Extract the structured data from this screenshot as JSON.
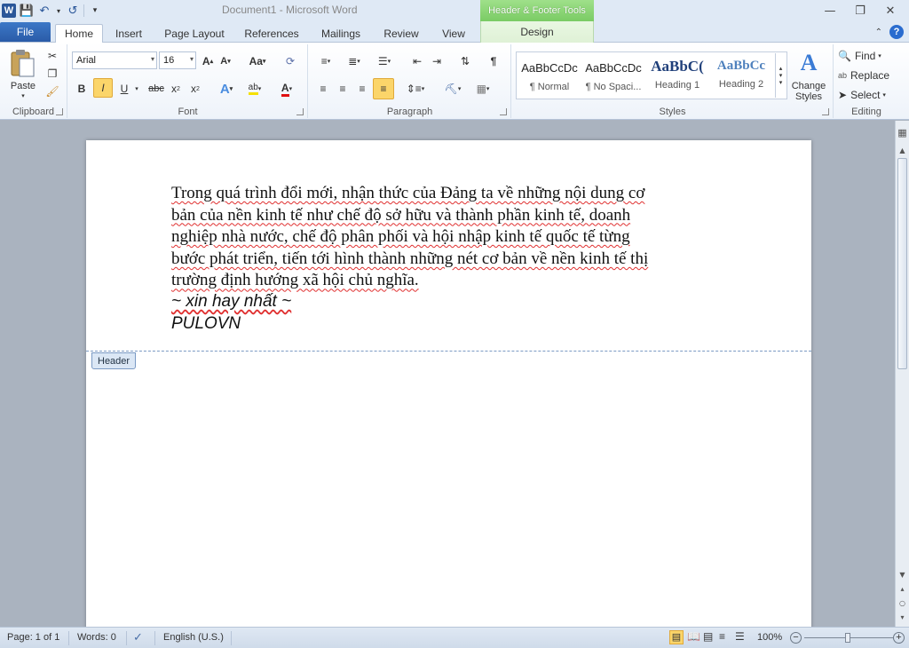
{
  "window": {
    "title": "Document1 - Microsoft Word",
    "context_tab_title": "Header & Footer Tools"
  },
  "tabs": {
    "file": "File",
    "items": [
      "Home",
      "Insert",
      "Page Layout",
      "References",
      "Mailings",
      "Review",
      "View"
    ],
    "design": "Design",
    "active": "Home"
  },
  "ribbon": {
    "clipboard": {
      "label": "Clipboard",
      "paste": "Paste"
    },
    "font": {
      "label": "Font",
      "name": "Arial",
      "size": "16"
    },
    "paragraph": {
      "label": "Paragraph"
    },
    "styles": {
      "label": "Styles",
      "items": [
        {
          "sample": "AaBbCcDc",
          "name": "¶ Normal"
        },
        {
          "sample": "AaBbCcDc",
          "name": "¶ No Spaci..."
        },
        {
          "sample": "AaBbC(",
          "name": "Heading 1"
        },
        {
          "sample": "AaBbCc",
          "name": "Heading 2"
        }
      ],
      "change_styles": "Change Styles"
    },
    "editing": {
      "label": "Editing",
      "find": "Find",
      "replace": "Replace",
      "select": "Select"
    }
  },
  "document": {
    "paragraph_lines": [
      "Trong quá trình đổi mới, nhận thức của Đảng ta về những nội dung cơ",
      "bản của nền kinh tế như chế độ sở hữu và thành phần kinh tế, doanh",
      "nghiệp nhà nước, chế độ phân phối và hội nhập kinh tế quốc tế từng",
      "bước phát triển, tiến tới hình thành những nét cơ bản về nền kinh tế thị",
      "trường định hướng xã hội chủ nghĩa."
    ],
    "line_tagline": "~ xin hay nhất ~",
    "line_brand": "PULOVN",
    "header_tag": "Header"
  },
  "statusbar": {
    "page": "Page: 1 of 1",
    "words": "Words: 0",
    "language": "English (U.S.)",
    "zoom": "100%",
    "zoom_level": 1.0
  }
}
